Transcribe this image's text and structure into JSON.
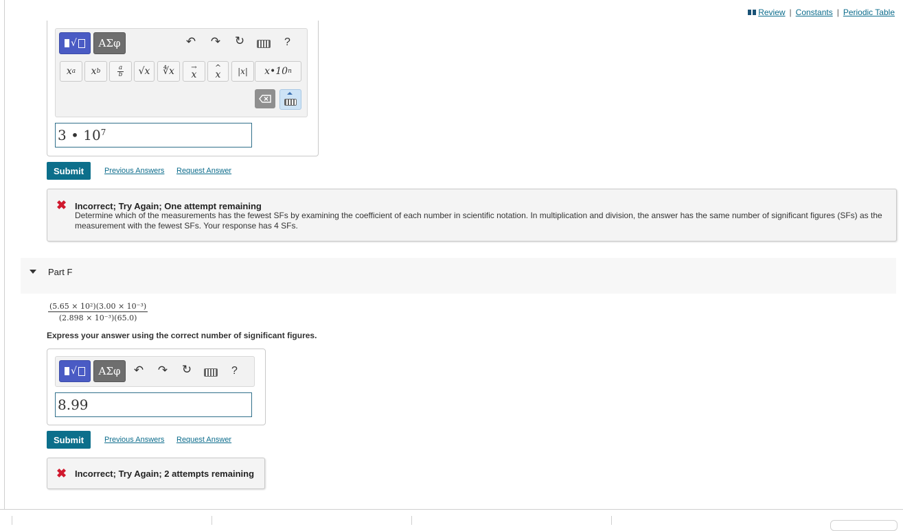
{
  "top_links": {
    "review": "Review",
    "constants": "Constants",
    "periodic_table": "Periodic Table",
    "separator": "|"
  },
  "toolbar": {
    "greek_label": "ΑΣφ",
    "undo_icon": "↶",
    "redo_icon": "↷",
    "reset_icon": "↻",
    "help_label": "?",
    "template_keys": {
      "superscript": "x",
      "superscript_sup": "a",
      "subscript": "x",
      "subscript_sub": "b",
      "fraction_num": "a",
      "fraction_den": "b",
      "sqrt": "√x",
      "nthroot": "∜x",
      "vector": "x",
      "vector_mark": "→",
      "unit_vector": "x",
      "unit_mark": "^",
      "abs": "|x|",
      "sci_notation": "x•10",
      "sci_sup": "n"
    }
  },
  "part_e": {
    "answer_base": "3 • 10",
    "answer_exp": "7",
    "submit": "Submit",
    "previous_answers": "Previous Answers",
    "request_answer": "Request Answer",
    "feedback_title": "Incorrect; Try Again; One attempt remaining",
    "feedback_body": "Determine which of the measurements has the fewest SFs by examining the coefficient of each number in scientific notation. In multiplication and division, the answer has the same number of significant figures (SFs) as the measurement with the fewest SFs. Your response has 4 SFs."
  },
  "part_f": {
    "label": "Part F",
    "fraction_numerator": "(5.65 × 10²)(3.00 × 10⁻³)",
    "fraction_denominator": "(2.898 × 10⁻³)(65.0)",
    "instruction": "Express your answer using the correct number of significant figures.",
    "answer": "8.99",
    "submit": "Submit",
    "previous_answers": "Previous Answers",
    "request_answer": "Request Answer",
    "feedback_title": "Incorrect; Try Again; 2 attempts remaining"
  },
  "colors": {
    "accent": "#0c6f8b",
    "error": "#d0192e",
    "template_button": "#4a5bc4"
  }
}
